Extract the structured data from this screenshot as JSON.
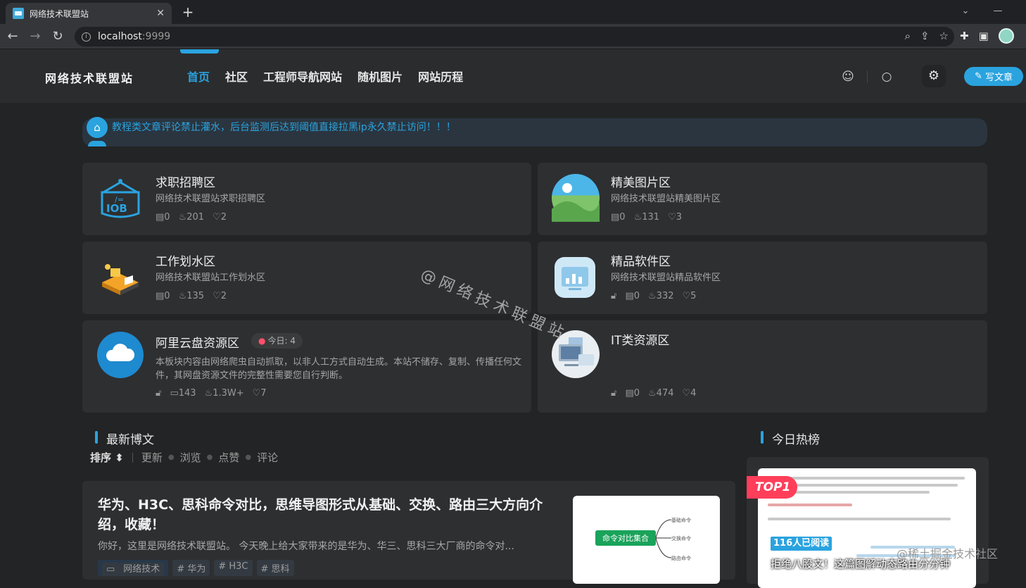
{
  "browser": {
    "tab_title": "网络技术联盟站",
    "url_host": "localhost",
    "url_port": ":9999"
  },
  "site": {
    "logo": "网络技术联盟站",
    "nav": [
      "首页",
      "社区",
      "工程师导航网站",
      "随机图片",
      "网站历程"
    ],
    "write_label": "写文章"
  },
  "notice": "教程类文章评论禁止灌水，后台监测后达到阈值直接拉黑ip永久禁止访问！！！",
  "watermark": "@网络技术联盟站",
  "cards": [
    {
      "title": "求职招聘区",
      "desc": "网络技术联盟站求职招聘区",
      "posts": "0",
      "views": "201",
      "likes": "2"
    },
    {
      "title": "精美图片区",
      "desc": "网络技术联盟站精美图片区",
      "posts": "0",
      "views": "131",
      "likes": "3"
    },
    {
      "title": "工作划水区",
      "desc": "网络技术联盟站工作划水区",
      "posts": "0",
      "views": "135",
      "likes": "2"
    },
    {
      "title": "精品软件区",
      "desc": "网络技术联盟站精品软件区",
      "posts": "0",
      "views": "332",
      "likes": "5"
    },
    {
      "title": "阿里云盘资源区",
      "today": "今日: 4",
      "desc": "本板块内容由网络爬虫自动抓取，以非人工方式自动生成。本站不储存、复制、传播任何文件，其网盘资源文件的完整性需要您自行判断。",
      "posts": "143",
      "views": "1.3W+",
      "likes": "7"
    },
    {
      "title": "IT类资源区",
      "desc": "",
      "posts": "0",
      "views": "474",
      "likes": "4"
    }
  ],
  "latest": {
    "heading": "最新博文",
    "sort_label": "排序",
    "sort_options": [
      "更新",
      "浏览",
      "点赞",
      "评论"
    ]
  },
  "post": {
    "title": "华为、H3C、思科命令对比，思维导图形式从基础、交换、路由三大方向介绍，收藏！",
    "excerpt": "你好，这里是网络技术联盟站。 今天晚上给大家带来的是华为、华三、思科三大厂商的命令对...",
    "category": "网络技术",
    "tags": [
      "# 华为",
      "# H3C",
      "# 思科"
    ],
    "thumb_center": "命令对比集合",
    "thumb_nodes": [
      "基础命令",
      "交换命令",
      "路由命令"
    ]
  },
  "hot": {
    "heading": "今日热榜",
    "rank": "TOP1",
    "reads": "116人已阅读",
    "title": "拒绝八股文！这篇图解动态路由分分钟",
    "source_mark": "@稀土掘金技术社区"
  }
}
